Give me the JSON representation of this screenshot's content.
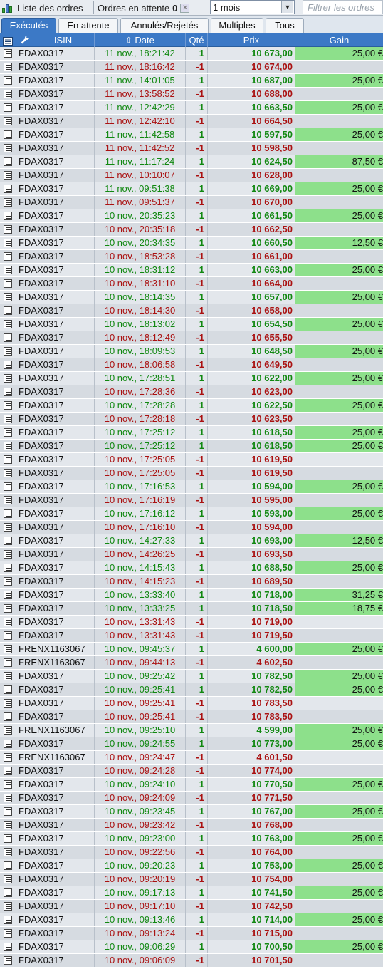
{
  "toolbar": {
    "title": "Liste des ordres",
    "pending_label": "Ordres en attente",
    "pending_count": "0",
    "period": "1 mois",
    "filter_placeholder": "Filtrer les ordres"
  },
  "tabs": [
    {
      "label": "Exécutés",
      "active": true
    },
    {
      "label": "En attente",
      "active": false
    },
    {
      "label": "Annulés/Rejetés",
      "active": false
    },
    {
      "label": "Multiples",
      "active": false
    },
    {
      "label": "Tous",
      "active": false
    }
  ],
  "columns": {
    "isin": "ISIN",
    "date": "Date",
    "qty": "Qté",
    "price": "Prix",
    "gain": "Gain"
  },
  "colors": {
    "header_blue": "#3c79c6",
    "buy_green": "#118811",
    "sell_red": "#aa1111",
    "gain_green": "#8de08b"
  },
  "rows": [
    {
      "isin": "FDAX0317",
      "date": "11 nov., 18:21:42",
      "qty": "1",
      "price": "10 673,00",
      "gain": "25,00 €"
    },
    {
      "isin": "FDAX0317",
      "date": "11 nov., 18:16:42",
      "qty": "-1",
      "price": "10 674,00",
      "gain": ""
    },
    {
      "isin": "FDAX0317",
      "date": "11 nov., 14:01:05",
      "qty": "1",
      "price": "10 687,00",
      "gain": "25,00 €"
    },
    {
      "isin": "FDAX0317",
      "date": "11 nov., 13:58:52",
      "qty": "-1",
      "price": "10 688,00",
      "gain": ""
    },
    {
      "isin": "FDAX0317",
      "date": "11 nov., 12:42:29",
      "qty": "1",
      "price": "10 663,50",
      "gain": "25,00 €"
    },
    {
      "isin": "FDAX0317",
      "date": "11 nov., 12:42:10",
      "qty": "-1",
      "price": "10 664,50",
      "gain": ""
    },
    {
      "isin": "FDAX0317",
      "date": "11 nov., 11:42:58",
      "qty": "1",
      "price": "10 597,50",
      "gain": "25,00 €"
    },
    {
      "isin": "FDAX0317",
      "date": "11 nov., 11:42:52",
      "qty": "-1",
      "price": "10 598,50",
      "gain": ""
    },
    {
      "isin": "FDAX0317",
      "date": "11 nov., 11:17:24",
      "qty": "1",
      "price": "10 624,50",
      "gain": "87,50 €"
    },
    {
      "isin": "FDAX0317",
      "date": "11 nov., 10:10:07",
      "qty": "-1",
      "price": "10 628,00",
      "gain": ""
    },
    {
      "isin": "FDAX0317",
      "date": "11 nov., 09:51:38",
      "qty": "1",
      "price": "10 669,00",
      "gain": "25,00 €"
    },
    {
      "isin": "FDAX0317",
      "date": "11 nov., 09:51:37",
      "qty": "-1",
      "price": "10 670,00",
      "gain": ""
    },
    {
      "isin": "FDAX0317",
      "date": "10 nov., 20:35:23",
      "qty": "1",
      "price": "10 661,50",
      "gain": "25,00 €"
    },
    {
      "isin": "FDAX0317",
      "date": "10 nov., 20:35:18",
      "qty": "-1",
      "price": "10 662,50",
      "gain": ""
    },
    {
      "isin": "FDAX0317",
      "date": "10 nov., 20:34:35",
      "qty": "1",
      "price": "10 660,50",
      "gain": "12,50 €"
    },
    {
      "isin": "FDAX0317",
      "date": "10 nov., 18:53:28",
      "qty": "-1",
      "price": "10 661,00",
      "gain": ""
    },
    {
      "isin": "FDAX0317",
      "date": "10 nov., 18:31:12",
      "qty": "1",
      "price": "10 663,00",
      "gain": "25,00 €"
    },
    {
      "isin": "FDAX0317",
      "date": "10 nov., 18:31:10",
      "qty": "-1",
      "price": "10 664,00",
      "gain": ""
    },
    {
      "isin": "FDAX0317",
      "date": "10 nov., 18:14:35",
      "qty": "1",
      "price": "10 657,00",
      "gain": "25,00 €"
    },
    {
      "isin": "FDAX0317",
      "date": "10 nov., 18:14:30",
      "qty": "-1",
      "price": "10 658,00",
      "gain": ""
    },
    {
      "isin": "FDAX0317",
      "date": "10 nov., 18:13:02",
      "qty": "1",
      "price": "10 654,50",
      "gain": "25,00 €"
    },
    {
      "isin": "FDAX0317",
      "date": "10 nov., 18:12:49",
      "qty": "-1",
      "price": "10 655,50",
      "gain": ""
    },
    {
      "isin": "FDAX0317",
      "date": "10 nov., 18:09:53",
      "qty": "1",
      "price": "10 648,50",
      "gain": "25,00 €"
    },
    {
      "isin": "FDAX0317",
      "date": "10 nov., 18:06:58",
      "qty": "-1",
      "price": "10 649,50",
      "gain": ""
    },
    {
      "isin": "FDAX0317",
      "date": "10 nov., 17:28:51",
      "qty": "1",
      "price": "10 622,00",
      "gain": "25,00 €"
    },
    {
      "isin": "FDAX0317",
      "date": "10 nov., 17:28:36",
      "qty": "-1",
      "price": "10 623,00",
      "gain": ""
    },
    {
      "isin": "FDAX0317",
      "date": "10 nov., 17:28:28",
      "qty": "1",
      "price": "10 622,50",
      "gain": "25,00 €"
    },
    {
      "isin": "FDAX0317",
      "date": "10 nov., 17:28:18",
      "qty": "-1",
      "price": "10 623,50",
      "gain": ""
    },
    {
      "isin": "FDAX0317",
      "date": "10 nov., 17:25:12",
      "qty": "1",
      "price": "10 618,50",
      "gain": "25,00 €"
    },
    {
      "isin": "FDAX0317",
      "date": "10 nov., 17:25:12",
      "qty": "1",
      "price": "10 618,50",
      "gain": "25,00 €"
    },
    {
      "isin": "FDAX0317",
      "date": "10 nov., 17:25:05",
      "qty": "-1",
      "price": "10 619,50",
      "gain": ""
    },
    {
      "isin": "FDAX0317",
      "date": "10 nov., 17:25:05",
      "qty": "-1",
      "price": "10 619,50",
      "gain": ""
    },
    {
      "isin": "FDAX0317",
      "date": "10 nov., 17:16:53",
      "qty": "1",
      "price": "10 594,00",
      "gain": "25,00 €"
    },
    {
      "isin": "FDAX0317",
      "date": "10 nov., 17:16:19",
      "qty": "-1",
      "price": "10 595,00",
      "gain": ""
    },
    {
      "isin": "FDAX0317",
      "date": "10 nov., 17:16:12",
      "qty": "1",
      "price": "10 593,00",
      "gain": "25,00 €"
    },
    {
      "isin": "FDAX0317",
      "date": "10 nov., 17:16:10",
      "qty": "-1",
      "price": "10 594,00",
      "gain": ""
    },
    {
      "isin": "FDAX0317",
      "date": "10 nov., 14:27:33",
      "qty": "1",
      "price": "10 693,00",
      "gain": "12,50 €"
    },
    {
      "isin": "FDAX0317",
      "date": "10 nov., 14:26:25",
      "qty": "-1",
      "price": "10 693,50",
      "gain": ""
    },
    {
      "isin": "FDAX0317",
      "date": "10 nov., 14:15:43",
      "qty": "1",
      "price": "10 688,50",
      "gain": "25,00 €"
    },
    {
      "isin": "FDAX0317",
      "date": "10 nov., 14:15:23",
      "qty": "-1",
      "price": "10 689,50",
      "gain": ""
    },
    {
      "isin": "FDAX0317",
      "date": "10 nov., 13:33:40",
      "qty": "1",
      "price": "10 718,00",
      "gain": "31,25 €"
    },
    {
      "isin": "FDAX0317",
      "date": "10 nov., 13:33:25",
      "qty": "1",
      "price": "10 718,50",
      "gain": "18,75 €"
    },
    {
      "isin": "FDAX0317",
      "date": "10 nov., 13:31:43",
      "qty": "-1",
      "price": "10 719,00",
      "gain": ""
    },
    {
      "isin": "FDAX0317",
      "date": "10 nov., 13:31:43",
      "qty": "-1",
      "price": "10 719,50",
      "gain": ""
    },
    {
      "isin": "FRENX1163067",
      "date": "10 nov., 09:45:37",
      "qty": "1",
      "price": "4 600,00",
      "gain": "25,00 €"
    },
    {
      "isin": "FRENX1163067",
      "date": "10 nov., 09:44:13",
      "qty": "-1",
      "price": "4 602,50",
      "gain": ""
    },
    {
      "isin": "FDAX0317",
      "date": "10 nov., 09:25:42",
      "qty": "1",
      "price": "10 782,50",
      "gain": "25,00 €"
    },
    {
      "isin": "FDAX0317",
      "date": "10 nov., 09:25:41",
      "qty": "1",
      "price": "10 782,50",
      "gain": "25,00 €"
    },
    {
      "isin": "FDAX0317",
      "date": "10 nov., 09:25:41",
      "qty": "-1",
      "price": "10 783,50",
      "gain": ""
    },
    {
      "isin": "FDAX0317",
      "date": "10 nov., 09:25:41",
      "qty": "-1",
      "price": "10 783,50",
      "gain": ""
    },
    {
      "isin": "FRENX1163067",
      "date": "10 nov., 09:25:10",
      "qty": "1",
      "price": "4 599,00",
      "gain": "25,00 €"
    },
    {
      "isin": "FDAX0317",
      "date": "10 nov., 09:24:55",
      "qty": "1",
      "price": "10 773,00",
      "gain": "25,00 €"
    },
    {
      "isin": "FRENX1163067",
      "date": "10 nov., 09:24:47",
      "qty": "-1",
      "price": "4 601,50",
      "gain": ""
    },
    {
      "isin": "FDAX0317",
      "date": "10 nov., 09:24:28",
      "qty": "-1",
      "price": "10 774,00",
      "gain": ""
    },
    {
      "isin": "FDAX0317",
      "date": "10 nov., 09:24:10",
      "qty": "1",
      "price": "10 770,50",
      "gain": "25,00 €"
    },
    {
      "isin": "FDAX0317",
      "date": "10 nov., 09:24:09",
      "qty": "-1",
      "price": "10 771,50",
      "gain": ""
    },
    {
      "isin": "FDAX0317",
      "date": "10 nov., 09:23:45",
      "qty": "1",
      "price": "10 767,00",
      "gain": "25,00 €"
    },
    {
      "isin": "FDAX0317",
      "date": "10 nov., 09:23:42",
      "qty": "-1",
      "price": "10 768,00",
      "gain": ""
    },
    {
      "isin": "FDAX0317",
      "date": "10 nov., 09:23:00",
      "qty": "1",
      "price": "10 763,00",
      "gain": "25,00 €"
    },
    {
      "isin": "FDAX0317",
      "date": "10 nov., 09:22:56",
      "qty": "-1",
      "price": "10 764,00",
      "gain": ""
    },
    {
      "isin": "FDAX0317",
      "date": "10 nov., 09:20:23",
      "qty": "1",
      "price": "10 753,00",
      "gain": "25,00 €"
    },
    {
      "isin": "FDAX0317",
      "date": "10 nov., 09:20:19",
      "qty": "-1",
      "price": "10 754,00",
      "gain": ""
    },
    {
      "isin": "FDAX0317",
      "date": "10 nov., 09:17:13",
      "qty": "1",
      "price": "10 741,50",
      "gain": "25,00 €"
    },
    {
      "isin": "FDAX0317",
      "date": "10 nov., 09:17:10",
      "qty": "-1",
      "price": "10 742,50",
      "gain": ""
    },
    {
      "isin": "FDAX0317",
      "date": "10 nov., 09:13:46",
      "qty": "1",
      "price": "10 714,00",
      "gain": "25,00 €"
    },
    {
      "isin": "FDAX0317",
      "date": "10 nov., 09:13:24",
      "qty": "-1",
      "price": "10 715,00",
      "gain": ""
    },
    {
      "isin": "FDAX0317",
      "date": "10 nov., 09:06:29",
      "qty": "1",
      "price": "10 700,50",
      "gain": "25,00 €"
    },
    {
      "isin": "FDAX0317",
      "date": "10 nov., 09:06:09",
      "qty": "-1",
      "price": "10 701,50",
      "gain": ""
    }
  ]
}
